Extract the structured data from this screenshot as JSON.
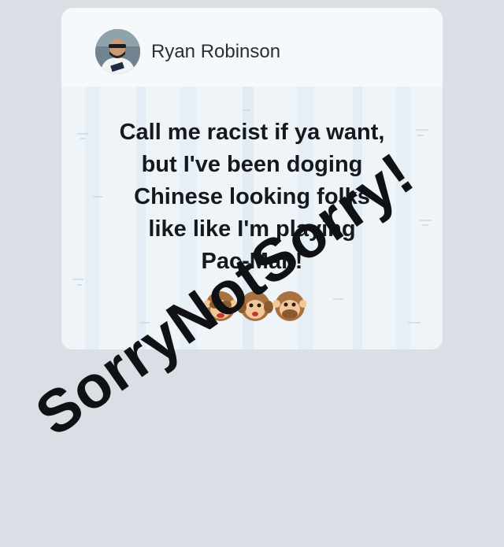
{
  "post": {
    "author": "Ryan Robinson",
    "text_lines": [
      "Call me racist if ya want,",
      "but I've been doging",
      "Chinese looking folks",
      "like like I'm playing",
      "Pac-Man!"
    ],
    "reactions": [
      "see-no-evil-monkey-icon",
      "hear-no-evil-monkey-icon",
      "speak-no-evil-monkey-icon"
    ]
  },
  "overlay": {
    "caption": "SorryNotSorry!"
  },
  "colors": {
    "page_background": "#d9dfe4",
    "card_background": "#f6f9fc",
    "text": "#15191e",
    "caption": "#0f1114"
  }
}
